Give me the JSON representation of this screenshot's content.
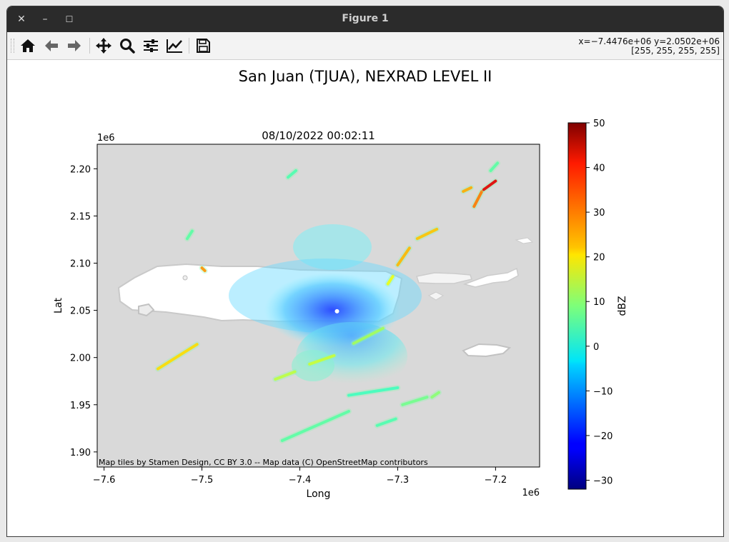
{
  "window": {
    "title": "Figure 1",
    "close_glyph": "✕",
    "minimize_glyph": "–",
    "maximize_glyph": "☐"
  },
  "toolbar": {
    "buttons": [
      {
        "name": "home",
        "icon": "home-icon"
      },
      {
        "name": "back",
        "icon": "arrow-left-icon"
      },
      {
        "name": "forward",
        "icon": "arrow-right-icon"
      },
      {
        "name": "pan",
        "icon": "move-icon"
      },
      {
        "name": "zoom",
        "icon": "magnifier-icon"
      },
      {
        "name": "subplots",
        "icon": "sliders-icon"
      },
      {
        "name": "axes",
        "icon": "line-chart-icon"
      },
      {
        "name": "save",
        "icon": "floppy-disk-icon"
      }
    ],
    "coords_line1": "x=−7.4476e+06 y=2.0502e+06",
    "coords_line2": "[255, 255, 255, 255]"
  },
  "figure": {
    "suptitle": "San Juan (TJUA), NEXRAD LEVEL II"
  },
  "chart_data": {
    "type": "heatmap",
    "title": "08/10/2022 00:02:11",
    "xlabel": "Long",
    "ylabel": "Lat",
    "x_offset_label": "1e6",
    "y_offset_label": "1e6",
    "xlim": [
      -7.607,
      -7.155
    ],
    "ylim": [
      1.884,
      2.226
    ],
    "x_ticks": [
      -7.6,
      -7.5,
      -7.4,
      -7.3,
      -7.2
    ],
    "x_tick_labels": [
      "−7.6",
      "−7.5",
      "−7.4",
      "−7.3",
      "−7.2"
    ],
    "y_ticks": [
      1.9,
      1.95,
      2.0,
      2.05,
      2.1,
      2.15,
      2.2
    ],
    "y_tick_labels": [
      "1.90",
      "1.95",
      "2.00",
      "2.05",
      "2.10",
      "2.15",
      "2.20"
    ],
    "attribution": "Map tiles by Stamen Design, CC BY 3.0 -- Map data (C) OpenStreetMap contributors",
    "background_color": "#d9d9d9",
    "land_color": "#ffffff",
    "colorbar": {
      "label": "dBZ",
      "colormap": "jet",
      "vmin": -32,
      "vmax": 50,
      "ticks": [
        50,
        40,
        30,
        20,
        10,
        0,
        -10,
        -20,
        -30
      ],
      "tick_labels": [
        "50",
        "40",
        "30",
        "20",
        "10",
        "0",
        "−10",
        "−20",
        "−30"
      ]
    },
    "radar_site": {
      "x": -7.362,
      "y": 2.049
    },
    "echo_bands": [
      {
        "x1": -7.545,
        "y1": 1.988,
        "x2": -7.505,
        "y2": 2.014,
        "dbz": 22
      },
      {
        "x1": -7.497,
        "y1": 2.092,
        "x2": -7.5,
        "y2": 2.095,
        "dbz": 28
      },
      {
        "x1": -7.3,
        "y1": 2.098,
        "x2": -7.288,
        "y2": 2.116,
        "dbz": 25
      },
      {
        "x1": -7.28,
        "y1": 2.126,
        "x2": -7.26,
        "y2": 2.136,
        "dbz": 24
      },
      {
        "x1": -7.233,
        "y1": 2.176,
        "x2": -7.225,
        "y2": 2.18,
        "dbz": 26
      },
      {
        "x1": -7.222,
        "y1": 2.16,
        "x2": -7.214,
        "y2": 2.176,
        "dbz": 30
      },
      {
        "x1": -7.212,
        "y1": 2.178,
        "x2": -7.2,
        "y2": 2.187,
        "dbz": 42
      },
      {
        "x1": -7.425,
        "y1": 1.977,
        "x2": -7.405,
        "y2": 1.985,
        "dbz": 14
      },
      {
        "x1": -7.39,
        "y1": 1.993,
        "x2": -7.365,
        "y2": 2.002,
        "dbz": 15
      },
      {
        "x1": -7.345,
        "y1": 2.015,
        "x2": -7.315,
        "y2": 2.031,
        "dbz": 12
      },
      {
        "x1": -7.31,
        "y1": 2.078,
        "x2": -7.305,
        "y2": 2.086,
        "dbz": 18
      },
      {
        "x1": -7.418,
        "y1": 1.912,
        "x2": -7.35,
        "y2": 1.943,
        "dbz": 6
      },
      {
        "x1": -7.35,
        "y1": 1.96,
        "x2": -7.3,
        "y2": 1.968,
        "dbz": 4
      },
      {
        "x1": -7.295,
        "y1": 1.95,
        "x2": -7.27,
        "y2": 1.958,
        "dbz": 8
      },
      {
        "x1": -7.265,
        "y1": 1.958,
        "x2": -7.258,
        "y2": 1.963,
        "dbz": 10
      },
      {
        "x1": -7.321,
        "y1": 1.928,
        "x2": -7.302,
        "y2": 1.935,
        "dbz": 5
      },
      {
        "x1": -7.515,
        "y1": 2.126,
        "x2": -7.51,
        "y2": 2.134,
        "dbz": 6
      },
      {
        "x1": -7.412,
        "y1": 2.191,
        "x2": -7.404,
        "y2": 2.198,
        "dbz": 5
      },
      {
        "x1": -7.205,
        "y1": 2.198,
        "x2": -7.198,
        "y2": 2.206,
        "dbz": 6
      }
    ]
  }
}
